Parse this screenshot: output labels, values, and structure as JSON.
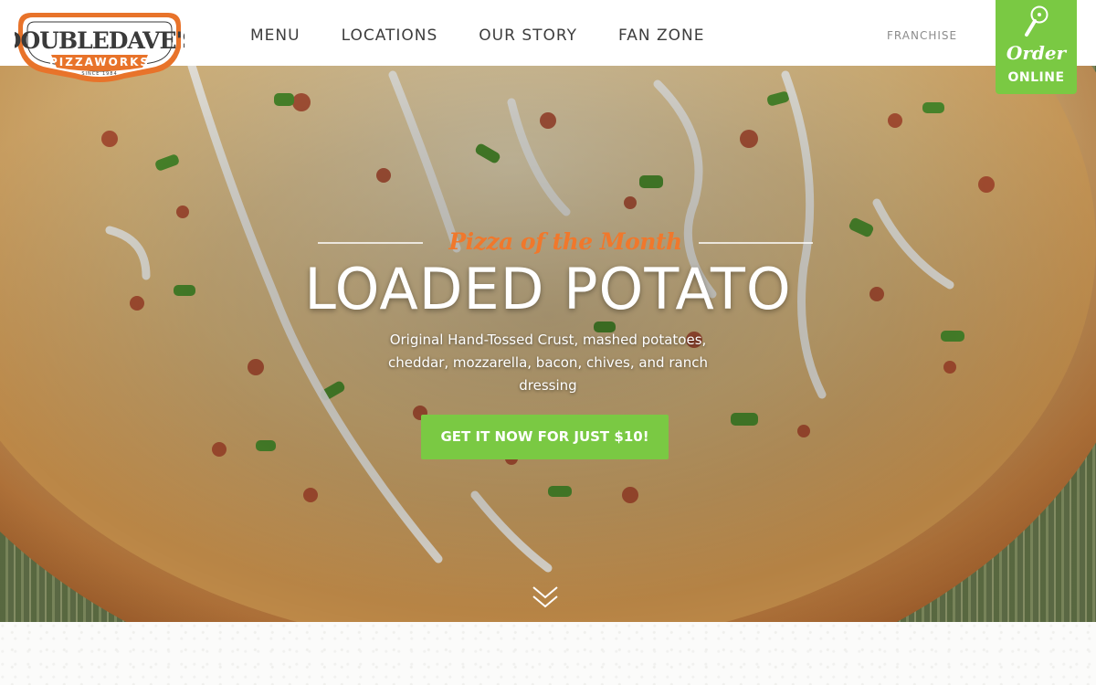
{
  "brand": {
    "logo_top": "DOUBLEDAVE'S",
    "logo_bottom": "PIZZAWORKS",
    "logo_since": "SINCE 1984",
    "colors": {
      "orange": "#f0782c",
      "green": "#7ac943",
      "dark": "#3d3d3d"
    }
  },
  "nav": {
    "items": [
      {
        "label": "MENU"
      },
      {
        "label": "LOCATIONS"
      },
      {
        "label": "OUR STORY"
      },
      {
        "label": "FAN ZONE"
      }
    ],
    "franchise": "FRANCHISE",
    "order": {
      "line1": "Order",
      "line2": "ONLINE",
      "icon": "pizza-cutter-icon"
    }
  },
  "hero": {
    "eyebrow": "Pizza of the Month",
    "title": "LOADED POTATO",
    "description": "Original Hand-Tossed Crust, mashed potatoes, cheddar, mozzarella, bacon, chives, and ranch dressing",
    "cta": "GET IT NOW FOR JUST $10!",
    "scroll_icon": "double-chevron-down-icon"
  }
}
